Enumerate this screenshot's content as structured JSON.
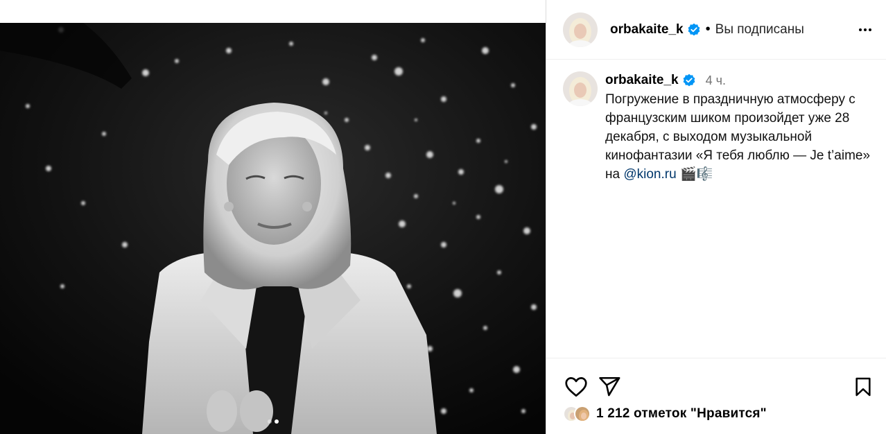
{
  "post": {
    "username": "orbakaite_k",
    "following_label": "Вы подписаны",
    "separator": "•",
    "time_ago": "4 ч.",
    "caption_text": "Погружение в праздничную атмосферу с французским шиком произойдет уже 28 декабря, с выходом музыкальной кинофантазии «Я тебя люблю — Je t’aime» на",
    "caption_mention": "@kion.ru",
    "caption_emoji": "🎬🎼",
    "likes_label": "1 212 отметок \"Нравится\"",
    "carousel": {
      "count": 2,
      "active_index": 1
    }
  },
  "icons": {
    "verified": "verified-badge-icon",
    "more": "more-options-icon",
    "like": "heart-icon",
    "share": "paper-plane-icon",
    "save": "bookmark-icon"
  },
  "colors": {
    "verified": "#0095f6",
    "mention": "#00376b",
    "muted": "#737373",
    "border": "#dbdbdb"
  }
}
